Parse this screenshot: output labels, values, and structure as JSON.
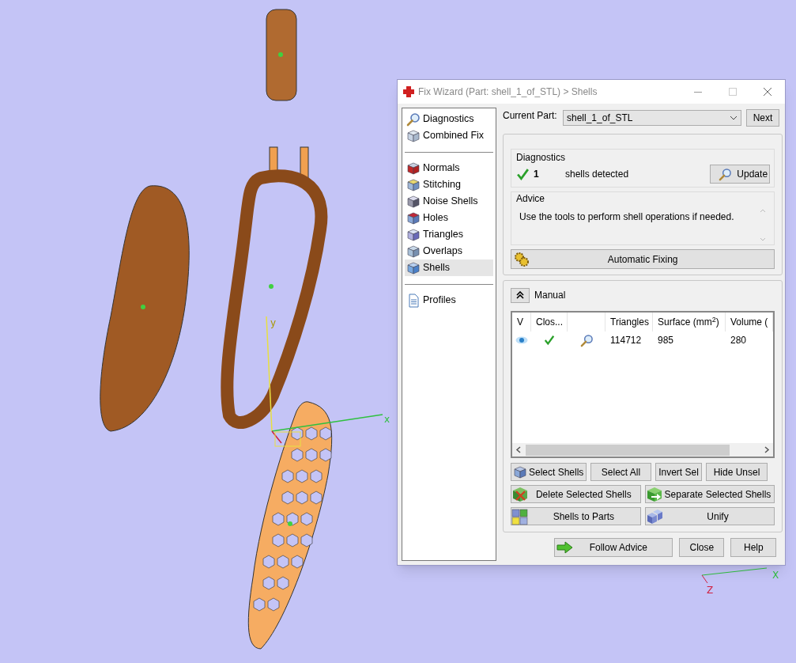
{
  "viewport": {
    "axis_labels": [
      {
        "text": "y",
        "kind": "y"
      },
      {
        "text": "x",
        "kind": "x"
      },
      {
        "text": "X",
        "kind": "x2"
      },
      {
        "text": "Z",
        "kind": "z2"
      }
    ]
  },
  "window": {
    "title": "Fix Wizard (Part: shell_1_of_STL) > Shells"
  },
  "sidebar": {
    "groups": [
      [
        {
          "label": "Diagnostics",
          "selected": false
        },
        {
          "label": "Combined Fix",
          "selected": false
        }
      ],
      [
        {
          "label": "Normals",
          "selected": false
        },
        {
          "label": "Stitching",
          "selected": false
        },
        {
          "label": "Noise Shells",
          "selected": false
        },
        {
          "label": "Holes",
          "selected": false
        },
        {
          "label": "Triangles",
          "selected": false
        },
        {
          "label": "Overlaps",
          "selected": false
        },
        {
          "label": "Shells",
          "selected": true
        }
      ],
      [
        {
          "label": "Profiles",
          "selected": false
        }
      ]
    ]
  },
  "current_part": {
    "label": "Current Part:",
    "value": "shell_1_of_STL",
    "next": "Next"
  },
  "diagnostics": {
    "title": "Diagnostics",
    "count": "1",
    "text": "shells detected",
    "ok": true,
    "update": "Update"
  },
  "advice": {
    "title": "Advice",
    "text": "Use the tools to perform shell operations if needed."
  },
  "automatic_fixing": "Automatic Fixing",
  "manual": {
    "label": "Manual",
    "expanded": true,
    "table": {
      "columns": [
        "V",
        "Clos...",
        "",
        "Triangles",
        "Surface (mm$^{2}$)",
        "Volume ("
      ],
      "rows": [
        {
          "visible": true,
          "closed": true,
          "triangles": "114712",
          "surface": "985",
          "volume": "280"
        }
      ]
    },
    "button_rows": [
      [
        "Select Shells",
        "Select All",
        "Invert Sel",
        "Hide Unsel"
      ],
      [
        "Delete Selected Shells",
        "Separate Selected Shells"
      ],
      [
        "Shells to Parts",
        "Unify"
      ]
    ]
  },
  "footer": [
    "Follow Advice",
    "Close",
    "Help"
  ]
}
